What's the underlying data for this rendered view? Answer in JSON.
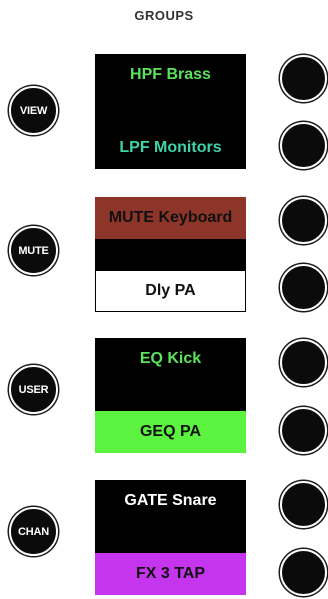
{
  "header": {
    "title": "GROUPS"
  },
  "side_buttons": [
    {
      "label": "VIEW"
    },
    {
      "label": "MUTE"
    },
    {
      "label": "USER"
    },
    {
      "label": "CHAN"
    }
  ],
  "panels": [
    {
      "top": {
        "label": "HPF Brass",
        "text_color": "#5ce25c",
        "bg": "#000000"
      },
      "bottom": {
        "label": "LPF Monitors",
        "text_color": "#3fd3a8",
        "bg": "#000000"
      },
      "panel_bg": "#000000"
    },
    {
      "top": {
        "label": "MUTE Keyboard",
        "text_color": "#111111",
        "bg": "#8e3529"
      },
      "bottom": {
        "label": "Dly PA",
        "text_color": "#111111",
        "bg": "#ffffff"
      },
      "panel_bg": "#000000"
    },
    {
      "top": {
        "label": "EQ Kick",
        "text_color": "#5ce25c",
        "bg": "#000000"
      },
      "bottom": {
        "label": "GEQ PA",
        "text_color": "#111111",
        "bg": "#5cf240"
      },
      "panel_bg": "#000000"
    },
    {
      "top": {
        "label": "GATE Snare",
        "text_color": "#ffffff",
        "bg": "#000000"
      },
      "bottom": {
        "label": "FX 3 TAP",
        "text_color": "#111111",
        "bg": "#c535ee"
      },
      "panel_bg": "#000000"
    }
  ],
  "knob_count": 8
}
